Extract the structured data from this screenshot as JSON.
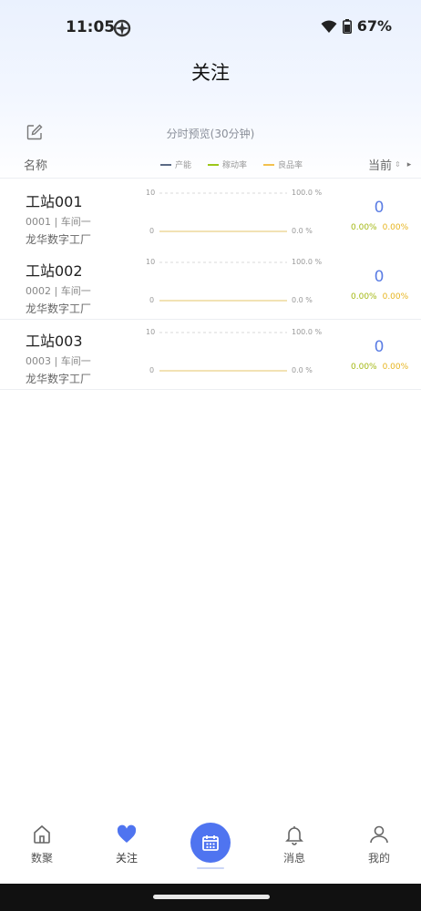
{
  "status_bar": {
    "time": "11:05",
    "battery_pct": "67%"
  },
  "page": {
    "title": "关注"
  },
  "header": {
    "chart_caption": "分时预览(30分钟)"
  },
  "columns": {
    "name": "名称",
    "current": "当前",
    "legend": [
      {
        "label": "产能",
        "color": "#5a6a85"
      },
      {
        "label": "稼动率",
        "color": "#9cc71a"
      },
      {
        "label": "良品率",
        "color": "#f2c14e"
      }
    ]
  },
  "chart_axis": {
    "y_max": "10",
    "y_min": "0",
    "pct_max": "100.0 %",
    "pct_min": "0.0 %"
  },
  "stations": [
    {
      "name": "工站001",
      "code": "0001 | 车间一",
      "factory": "龙华数字工厂",
      "current": "0",
      "utilization": "0.00%",
      "yield": "0.00%"
    },
    {
      "name": "工站002",
      "code": "0002 | 车间一",
      "factory": "龙华数字工厂",
      "current": "0",
      "utilization": "0.00%",
      "yield": "0.00%"
    },
    {
      "name": "工站003",
      "code": "0003 | 车间一",
      "factory": "龙华数字工厂",
      "current": "0",
      "utilization": "0.00%",
      "yield": "0.00%"
    }
  ],
  "tabbar": {
    "tabs": [
      {
        "label": "数聚",
        "icon": "home-icon"
      },
      {
        "label": "关注",
        "icon": "heart-icon"
      },
      {
        "label": "",
        "icon": "calendar-icon"
      },
      {
        "label": "消息",
        "icon": "bell-icon"
      },
      {
        "label": "我的",
        "icon": "user-icon"
      }
    ]
  },
  "colors": {
    "accent": "#4f74f0",
    "current_value": "#5b7de4",
    "utilization": "#a3b813",
    "yield": "#e6b41e"
  }
}
